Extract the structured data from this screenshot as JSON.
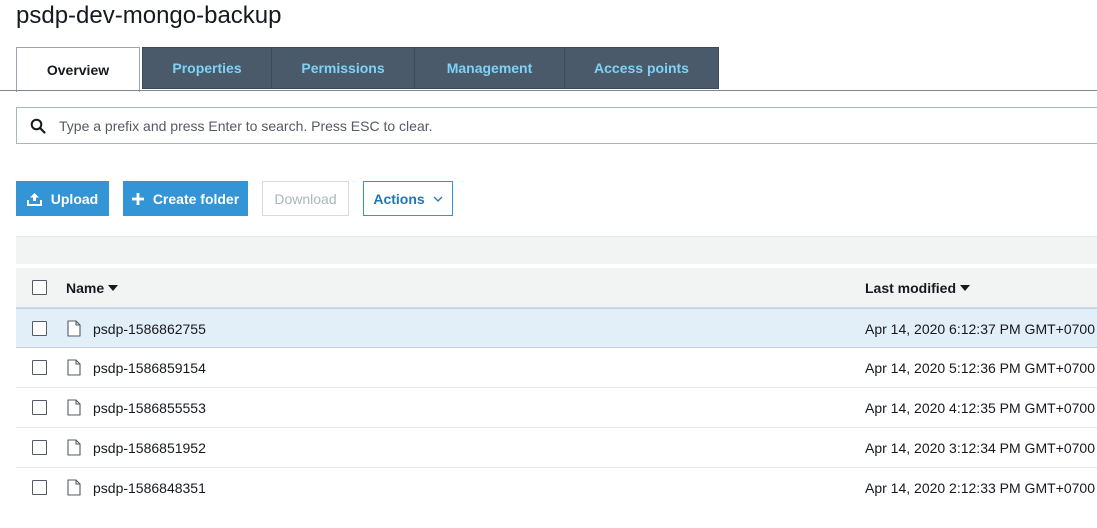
{
  "bucket": {
    "title": "psdp-dev-mongo-backup"
  },
  "tabs": [
    {
      "label": "Overview",
      "active": true
    },
    {
      "label": "Properties",
      "active": false
    },
    {
      "label": "Permissions",
      "active": false
    },
    {
      "label": "Management",
      "active": false
    },
    {
      "label": "Access points",
      "active": false
    }
  ],
  "search": {
    "placeholder": "Type a prefix and press Enter to search. Press ESC to clear.",
    "value": "",
    "icon": "search-icon"
  },
  "toolbar": {
    "upload_label": "Upload",
    "create_folder_label": "Create folder",
    "download_label": "Download",
    "actions_label": "Actions"
  },
  "table": {
    "columns": {
      "name": "Name",
      "last_modified": "Last modified"
    },
    "rows": [
      {
        "name": "psdp-1586862755",
        "last_modified": "Apr 14, 2020 6:12:37 PM GMT+0700",
        "selected": true
      },
      {
        "name": "psdp-1586859154",
        "last_modified": "Apr 14, 2020 5:12:36 PM GMT+0700",
        "selected": false
      },
      {
        "name": "psdp-1586855553",
        "last_modified": "Apr 14, 2020 4:12:35 PM GMT+0700",
        "selected": false
      },
      {
        "name": "psdp-1586851952",
        "last_modified": "Apr 14, 2020 3:12:34 PM GMT+0700",
        "selected": false
      },
      {
        "name": "psdp-1586848351",
        "last_modified": "Apr 14, 2020 2:12:33 PM GMT+0700",
        "selected": false
      }
    ]
  },
  "colors": {
    "tab_bg": "#4a5a6b",
    "tab_text": "#7dd3f5",
    "primary": "#3394d6",
    "selected_row": "#e2eff8"
  }
}
